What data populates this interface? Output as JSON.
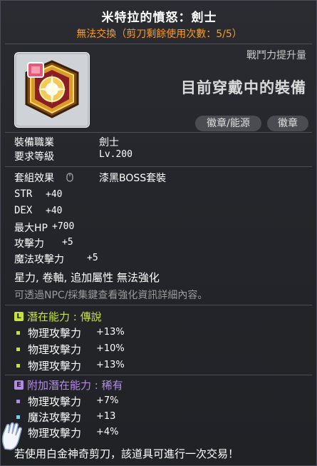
{
  "item": {
    "name": "米特拉的憤怒：劍士",
    "trade_note": "無法交換（剪刀剩餘使用次數：5/5）",
    "power_label": "戰鬥力提升量",
    "wearing_label": "目前穿戴中的裝備",
    "tags": [
      "徽章/能源",
      "徽章"
    ]
  },
  "info": {
    "job_label": "裝備職業",
    "job_value": "劍士",
    "level_label": "要求等級",
    "level_value": "Lv.200",
    "set_label": "套組效果",
    "set_value": "漆黑BOSS套裝"
  },
  "stats": [
    {
      "name": "STR",
      "value": "+40"
    },
    {
      "name": "DEX",
      "value": "+40"
    },
    {
      "name": "最大HP",
      "value": "+700"
    },
    {
      "name": "攻擊力",
      "value": "+5"
    },
    {
      "name": "魔法攻擊力",
      "value": "+5"
    }
  ],
  "flags": "星力, 卷軸, 追加屬性 無法強化",
  "hint": "可透過NPC/採集鍵查看強化資訊詳細內容。",
  "potential": {
    "icon_letter": "L",
    "label": "潛在能力 : 傳說",
    "color": "#c6e33a",
    "lines": [
      {
        "name": "物理攻擊力",
        "value": "+13%"
      },
      {
        "name": "物理攻擊力",
        "value": "+10%"
      },
      {
        "name": "物理攻擊力",
        "value": "+13%"
      }
    ]
  },
  "additional": {
    "icon_letter": "E",
    "label_main": "附加潛在能力",
    "label_sep": " : ",
    "label_grade": "稀有",
    "color": "#b48ce6",
    "lines": [
      {
        "name": "物理攻擊力",
        "value": "+7%",
        "bullet": "#b48ce6"
      },
      {
        "name": "魔法攻擊力",
        "value": "+13",
        "bullet": "#6fd2ee"
      },
      {
        "name": "物理攻擊力",
        "value": "+4%",
        "bullet": "#6fd2ee"
      }
    ]
  },
  "footer": "若使用白金神奇剪刀，該道具可進行一次交易！"
}
